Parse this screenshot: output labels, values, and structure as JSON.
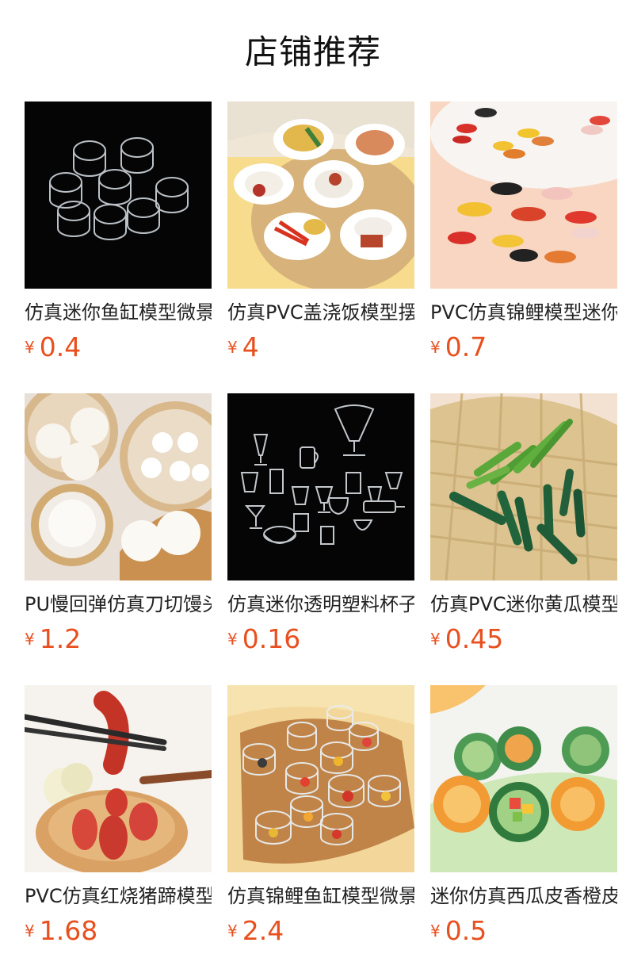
{
  "header": {
    "title": "店铺推荐"
  },
  "currency_symbol": "¥",
  "colors": {
    "price": "#e8501f",
    "text": "#222222"
  },
  "products": [
    {
      "name": "仿真迷你鱼缸模型微景观",
      "price": "0.4",
      "image": "clear-fish-tanks-on-black"
    },
    {
      "name": "仿真PVC盖浇饭模型摆件",
      "price": "4",
      "image": "rice-dishes-on-plates"
    },
    {
      "name": "PVC仿真锦鲤模型迷你摆件",
      "price": "0.7",
      "image": "koi-fish-figurines"
    },
    {
      "name": "PU慢回弹仿真刀切馒头",
      "price": "1.2",
      "image": "steamed-buns-in-bamboo-steamer"
    },
    {
      "name": "仿真迷你透明塑料杯子",
      "price": "0.16",
      "image": "clear-mini-cups-on-black"
    },
    {
      "name": "仿真PVC迷你黄瓜模型",
      "price": "0.45",
      "image": "cucumbers-on-bamboo-basket"
    },
    {
      "name": "PVC仿真红烧猪蹄模型",
      "price": "1.68",
      "image": "braised-pork-trotters-with-chopsticks"
    },
    {
      "name": "仿真锦鲤鱼缸模型微景观",
      "price": "2.4",
      "image": "koi-in-clear-bowls-on-wood"
    },
    {
      "name": "迷你仿真西瓜皮香橙皮",
      "price": "0.5",
      "image": "watermelon-and-orange-rind-cups"
    }
  ]
}
